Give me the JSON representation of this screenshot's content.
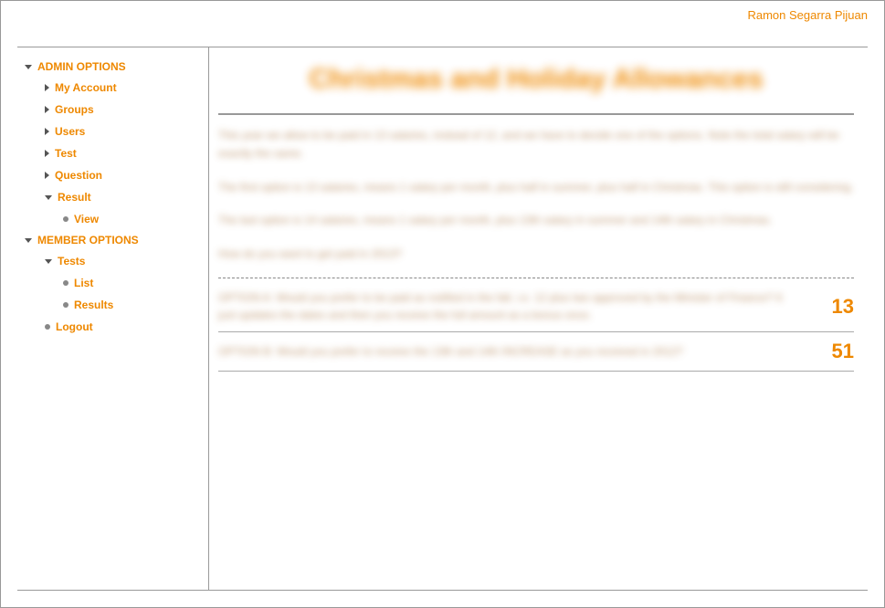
{
  "user_name": "Ramon Segarra Pijuan",
  "sidebar": {
    "admin_header": "ADMIN OPTIONS",
    "admin_items": {
      "my_account": "My Account",
      "groups": "Groups",
      "users": "Users",
      "test": "Test",
      "question": "Question",
      "result": "Result",
      "result_view": "View"
    },
    "member_header": "MEMBER OPTIONS",
    "member_items": {
      "tests": "Tests",
      "tests_list": "List",
      "tests_results": "Results"
    },
    "logout": "Logout"
  },
  "main": {
    "title": "Christmas and Holiday Allowances",
    "para1": "This year we allow to be paid in 13 salaries, instead of 12, and we have to decide one of the options. Note the total salary will be exactly the same.",
    "para2": "The first option is 13 salaries, means 1 salary per month, plus half in summer, plus half in Christmas. This option is still considering.",
    "para3": "The last option is 14 salaries, means 1 salary per month, plus 13th salary in summer and 14th salary in Christmas.",
    "para4": "How do you want to get paid in 2013?",
    "options": [
      {
        "label": "OPTION A: Would you prefer to be paid as notified in the fall, i.e. 12 plus two approved by the Minister of Finance? It just updates the dates and then you receive the full amount as a bonus once.",
        "count": "13"
      },
      {
        "label": "OPTION B: Would you prefer to receive the 13th and 14th INCREASE as you received in 2012?",
        "count": "51"
      }
    ]
  }
}
